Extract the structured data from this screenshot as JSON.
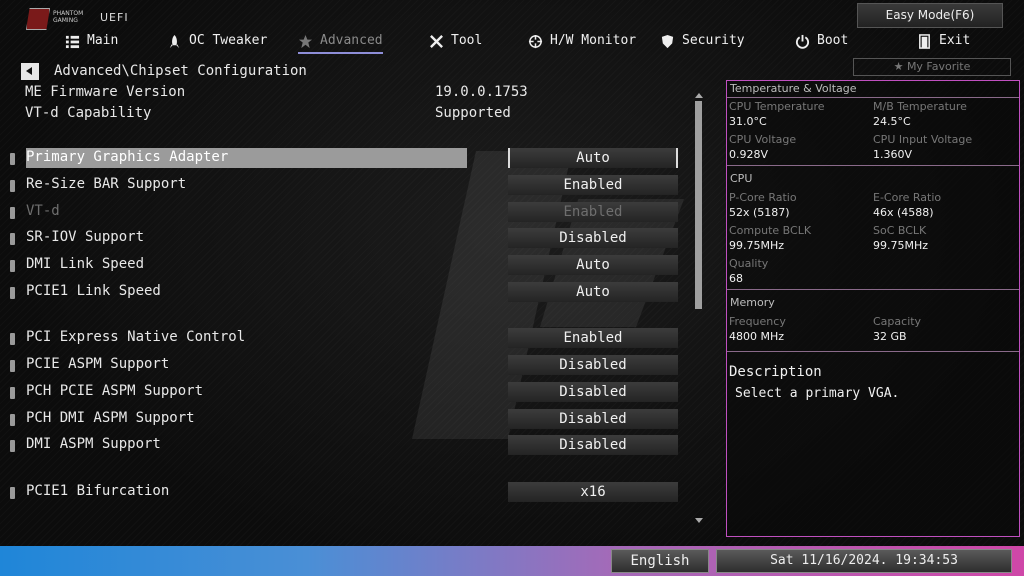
{
  "logo": {
    "brand_line1": "PHANTOM",
    "brand_line2": "GAMING",
    "firmware": "UEFI"
  },
  "easy_mode_label": "Easy Mode(F6)",
  "nav": [
    {
      "label": "Main",
      "icon": "list-icon"
    },
    {
      "label": "OC Tweaker",
      "icon": "rocket-icon"
    },
    {
      "label": "Advanced",
      "icon": "star-icon",
      "active": true
    },
    {
      "label": "Tool",
      "icon": "wrench-icon"
    },
    {
      "label": "H/W Monitor",
      "icon": "crosshair-icon"
    },
    {
      "label": "Security",
      "icon": "shield-icon"
    },
    {
      "label": "Boot",
      "icon": "power-icon"
    },
    {
      "label": "Exit",
      "icon": "exit-door-icon"
    }
  ],
  "breadcrumb": "Advanced\\Chipset Configuration",
  "favorite_label": "My Favorite",
  "info": [
    {
      "label": "ME Firmware Version",
      "value": "19.0.0.1753"
    },
    {
      "label": "VT-d Capability",
      "value": "Supported"
    }
  ],
  "settings": [
    {
      "label": "Primary Graphics Adapter",
      "value": "Auto",
      "selected": true
    },
    {
      "label": "Re-Size BAR Support",
      "value": "Enabled"
    },
    {
      "label": "VT-d",
      "value": "Enabled",
      "disabled": true
    },
    {
      "label": "SR-IOV Support",
      "value": "Disabled"
    },
    {
      "label": "DMI Link Speed",
      "value": "Auto"
    },
    {
      "label": "PCIE1 Link Speed",
      "value": "Auto"
    },
    {
      "label": "PCI Express Native Control",
      "value": "Enabled"
    },
    {
      "label": "PCIE ASPM Support",
      "value": "Disabled"
    },
    {
      "label": "PCH PCIE ASPM Support",
      "value": "Disabled"
    },
    {
      "label": "PCH DMI ASPM Support",
      "value": "Disabled"
    },
    {
      "label": "DMI ASPM Support",
      "value": "Disabled"
    },
    {
      "label": "PCIE1 Bifurcation",
      "value": "x16"
    }
  ],
  "panel": {
    "temp_header": "Temperature & Voltage",
    "cpu_temp_label": "CPU Temperature",
    "cpu_temp": "31.0°C",
    "mb_temp_label": "M/B Temperature",
    "mb_temp": "24.5°C",
    "cpu_volt_label": "CPU Voltage",
    "cpu_volt": "0.928V",
    "cpu_in_volt_label": "CPU Input Voltage",
    "cpu_in_volt": "1.360V",
    "cpu_header": "CPU",
    "pcore_label": "P-Core Ratio",
    "pcore": "52x (5187)",
    "ecore_label": "E-Core Ratio",
    "ecore": "46x (4588)",
    "cbclk_label": "Compute BCLK",
    "cbclk": "99.75MHz",
    "sbclk_label": "SoC BCLK",
    "sbclk": "99.75MHz",
    "quality_label": "Quality",
    "quality": "68",
    "mem_header": "Memory",
    "freq_label": "Frequency",
    "freq": "4800 MHz",
    "cap_label": "Capacity",
    "cap": "32 GB",
    "desc_title": "Description",
    "desc_text": "Select a primary VGA."
  },
  "language": "English",
  "datetime": "Sat 11/16/2024. 19:34:53",
  "colors": {
    "accent": "#8e8ed8",
    "panel_border": "#c050c0",
    "bar_left": "#1f86d8",
    "bar_right": "#cf47a8"
  }
}
